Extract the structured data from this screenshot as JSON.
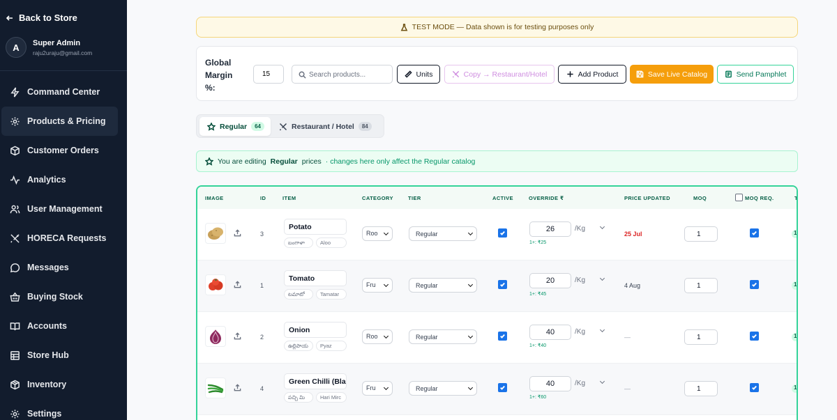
{
  "sidebar": {
    "back_label": "Back to Store",
    "user": {
      "initial": "A",
      "name": "Super Admin",
      "email": "raju2uraju@gmail.com"
    },
    "items": [
      {
        "label": "Command Center",
        "icon": "bolt-icon"
      },
      {
        "label": "Products & Pricing",
        "icon": "gear-icon",
        "active": true
      },
      {
        "label": "Customer Orders",
        "icon": "box-icon"
      },
      {
        "label": "Analytics",
        "icon": "activity-icon"
      },
      {
        "label": "User Management",
        "icon": "users-icon"
      },
      {
        "label": "HORECA Requests",
        "icon": "utensils-icon"
      },
      {
        "label": "Messages",
        "icon": "message-icon"
      },
      {
        "label": "Buying Stock",
        "icon": "basket-icon"
      },
      {
        "label": "Accounts",
        "icon": "book-icon"
      },
      {
        "label": "Store Hub",
        "icon": "store-icon"
      },
      {
        "label": "Inventory",
        "icon": "package-icon"
      },
      {
        "label": "Settings",
        "icon": "settings-icon"
      }
    ]
  },
  "banner": {
    "text": "TEST MODE — Data shown is for testing purposes only"
  },
  "toolbar": {
    "margin_label": "Global Margin %:",
    "margin_value": "15",
    "search_placeholder": "Search products...",
    "units_label": "Units",
    "copy_label": "Copy → Restaurant/Hotel",
    "add_label": "Add Product",
    "save_label": "Save Live Catalog",
    "send_label": "Send Pamphlet"
  },
  "tabs": [
    {
      "label": "Regular",
      "count": "64",
      "active": true
    },
    {
      "label": "Restaurant / Hotel",
      "count": "84",
      "active": false
    }
  ],
  "editing": {
    "prefix": "You are editing",
    "catalog": "Regular",
    "suffix": "prices",
    "note": "· changes here only affect the Regular catalog"
  },
  "table": {
    "headers": {
      "image": "IMAGE",
      "id": "ID",
      "item": "ITEM",
      "category": "CATEGORY",
      "tier": "TIER",
      "active": "ACTIVE",
      "override": "OVERRIDE ₹",
      "price_updated": "PRICE UPDATED",
      "moq": "MOQ",
      "moq_req": "MOQ REQ.",
      "trunc": "T"
    },
    "rows": [
      {
        "id": "3",
        "name": "Potato",
        "alias_local": "బంగాళా",
        "alias_hindi": "Aloo",
        "category": "Roo",
        "tier": "Regular",
        "override": "26",
        "unit": "/Kg",
        "tier_price": "1+: ₹25",
        "updated": "25 Jul",
        "moq": "1",
        "trunc": "1",
        "thumb": "potato"
      },
      {
        "id": "1",
        "name": "Tomato",
        "alias_local": "టమాటో",
        "alias_hindi": "Tamatar",
        "category": "Fru",
        "tier": "Regular",
        "override": "20",
        "unit": "/Kg",
        "tier_price": "1+: ₹45",
        "updated": "4 Aug",
        "moq": "1",
        "trunc": "1",
        "thumb": "tomato"
      },
      {
        "id": "2",
        "name": "Onion",
        "alias_local": "ఉల్లిపాయ",
        "alias_hindi": "Pyaz",
        "category": "Roo",
        "tier": "Regular",
        "override": "40",
        "unit": "/Kg",
        "tier_price": "1+: ₹40",
        "updated": "—",
        "moq": "1",
        "trunc": "1",
        "thumb": "onion"
      },
      {
        "id": "4",
        "name": "Green Chilli (Bla",
        "alias_local": "పచ్చి మి",
        "alias_hindi": "Hari Mirc",
        "category": "Fru",
        "tier": "Regular",
        "override": "40",
        "unit": "/Kg",
        "tier_price": "1+: ₹60",
        "updated": "—",
        "moq": "1",
        "trunc": "1",
        "thumb": "chilli"
      }
    ]
  },
  "colors": {
    "sidebar_bg": "#121c2d",
    "accent_green": "#34d399",
    "save_orange": "#f59e0b",
    "banner_bg": "#fef9e6"
  }
}
